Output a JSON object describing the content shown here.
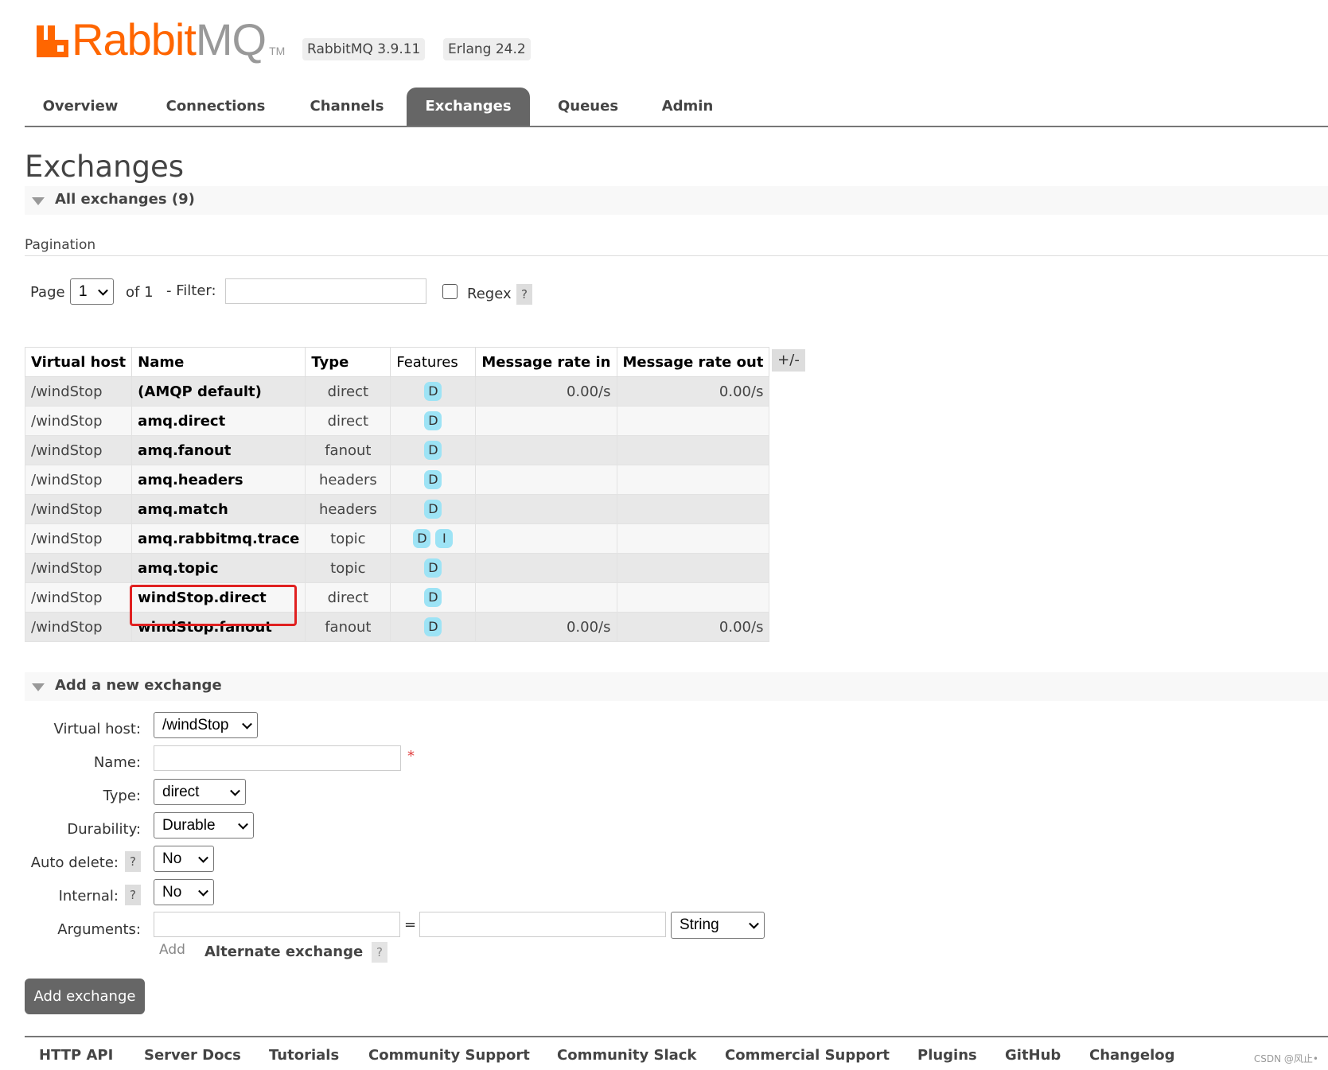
{
  "header": {
    "logo_text": "RabbitMQ",
    "logo_rabbit": "Rabbit",
    "logo_mq": "MQ",
    "logo_tm": "TM",
    "version": "RabbitMQ 3.9.11",
    "erlang": "Erlang 24.2"
  },
  "tabs": [
    {
      "label": "Overview"
    },
    {
      "label": "Connections"
    },
    {
      "label": "Channels"
    },
    {
      "label": "Exchanges",
      "active": true
    },
    {
      "label": "Queues"
    },
    {
      "label": "Admin"
    }
  ],
  "page_title": "Exchanges",
  "all_exchanges_label": "All exchanges (9)",
  "pagination": {
    "title": "Pagination",
    "page_label": "Page",
    "page_value": "1",
    "of_label": "of 1",
    "filter_label": "- Filter:",
    "filter_value": "",
    "regex_label": "Regex",
    "help": "?"
  },
  "table": {
    "headers": [
      "Virtual host",
      "Name",
      "Type",
      "Features",
      "Message rate in",
      "Message rate out"
    ],
    "plus_minus": "+/-",
    "rows": [
      {
        "vhost": "/windStop",
        "name": "(AMQP default)",
        "type": "direct",
        "features": [
          "D"
        ],
        "rate_in": "0.00/s",
        "rate_out": "0.00/s"
      },
      {
        "vhost": "/windStop",
        "name": "amq.direct",
        "type": "direct",
        "features": [
          "D"
        ],
        "rate_in": "",
        "rate_out": ""
      },
      {
        "vhost": "/windStop",
        "name": "amq.fanout",
        "type": "fanout",
        "features": [
          "D"
        ],
        "rate_in": "",
        "rate_out": ""
      },
      {
        "vhost": "/windStop",
        "name": "amq.headers",
        "type": "headers",
        "features": [
          "D"
        ],
        "rate_in": "",
        "rate_out": ""
      },
      {
        "vhost": "/windStop",
        "name": "amq.match",
        "type": "headers",
        "features": [
          "D"
        ],
        "rate_in": "",
        "rate_out": ""
      },
      {
        "vhost": "/windStop",
        "name": "amq.rabbitmq.trace",
        "type": "topic",
        "features": [
          "D",
          "I"
        ],
        "rate_in": "",
        "rate_out": ""
      },
      {
        "vhost": "/windStop",
        "name": "amq.topic",
        "type": "topic",
        "features": [
          "D"
        ],
        "rate_in": "",
        "rate_out": ""
      },
      {
        "vhost": "/windStop",
        "name": "windStop.direct",
        "type": "direct",
        "features": [
          "D"
        ],
        "rate_in": "",
        "rate_out": ""
      },
      {
        "vhost": "/windStop",
        "name": "windStop.fanout",
        "type": "fanout",
        "features": [
          "D"
        ],
        "rate_in": "0.00/s",
        "rate_out": "0.00/s"
      }
    ]
  },
  "add_exchange": {
    "section_label": "Add a new exchange",
    "vhost_label": "Virtual host:",
    "vhost_value": "/windStop",
    "name_label": "Name:",
    "name_value": "",
    "required_mark": "*",
    "type_label": "Type:",
    "type_value": "direct",
    "durability_label": "Durability:",
    "durability_value": "Durable",
    "auto_delete_label": "Auto delete:",
    "auto_delete_value": "No",
    "internal_label": "Internal:",
    "internal_value": "No",
    "arguments_label": "Arguments:",
    "equals": "=",
    "arg_type_value": "String",
    "add_link": "Add",
    "alternate_exchange": "Alternate exchange",
    "help": "?",
    "submit_label": "Add exchange"
  },
  "footer": {
    "links": [
      "HTTP API",
      "Server Docs",
      "Tutorials",
      "Community Support",
      "Community Slack",
      "Commercial Support",
      "Plugins",
      "GitHub",
      "Changelog"
    ]
  },
  "watermark": "CSDN @风止•"
}
